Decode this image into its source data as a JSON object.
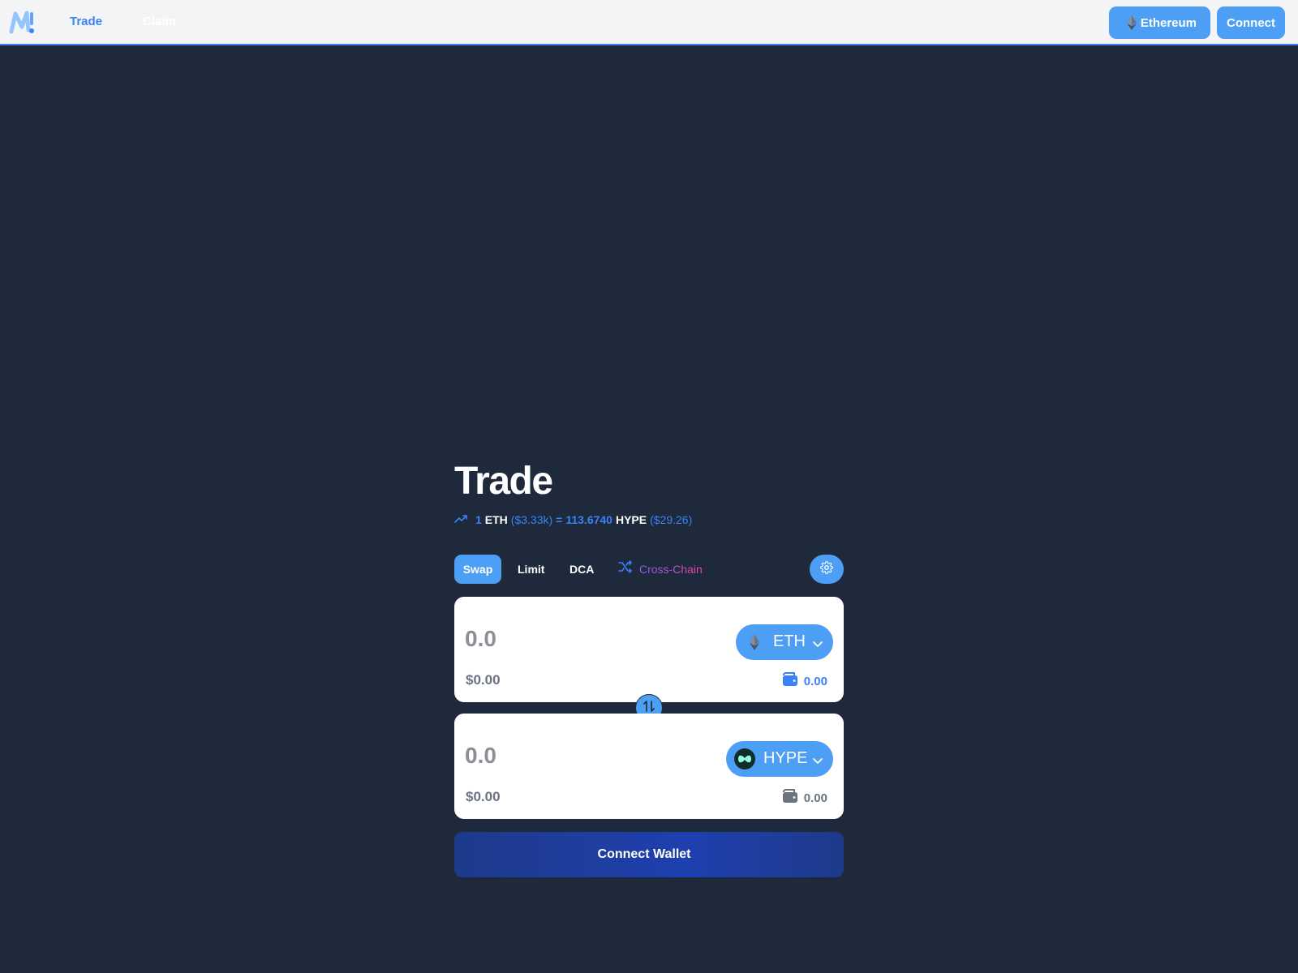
{
  "header": {
    "logo_icon": "m-logo-icon",
    "nav": [
      {
        "label": "Trade",
        "active": true
      },
      {
        "label": "Claim",
        "active": false
      }
    ],
    "network_button": {
      "label": "Ethereum",
      "icon": "ethereum-icon"
    },
    "connect_label": "Connect"
  },
  "trade": {
    "title": "Trade",
    "rate": {
      "icon": "trending-up-icon",
      "base_amount": "1",
      "base_symbol": "ETH",
      "base_usd": "($3.33k)",
      "equals": "=",
      "quote_amount": "113.6740",
      "quote_symbol": "HYPE",
      "quote_usd": "($29.26)"
    },
    "tabs": {
      "swap": "Swap",
      "limit": "Limit",
      "dca": "DCA",
      "cross_chain": "Cross-Chain",
      "active": "Swap"
    },
    "settings_icon": "gear-icon",
    "from": {
      "placeholder": "0.0",
      "usd": "$0.00",
      "token": "ETH",
      "token_icon": "ethereum-icon",
      "balance": "0.00",
      "balance_icon": "wallet-icon"
    },
    "to": {
      "placeholder": "0.0",
      "usd": "$0.00",
      "token": "HYPE",
      "token_icon": "hype-icon",
      "balance": "0.00",
      "balance_icon": "wallet-icon"
    },
    "switch_icon": "swap-arrows-icon",
    "connect_wallet_label": "Connect Wallet"
  },
  "colors": {
    "background": "#1e293b",
    "accent": "#4c9ff5",
    "link_blue": "#3b82f6",
    "wallet_button": "#1e40af"
  }
}
